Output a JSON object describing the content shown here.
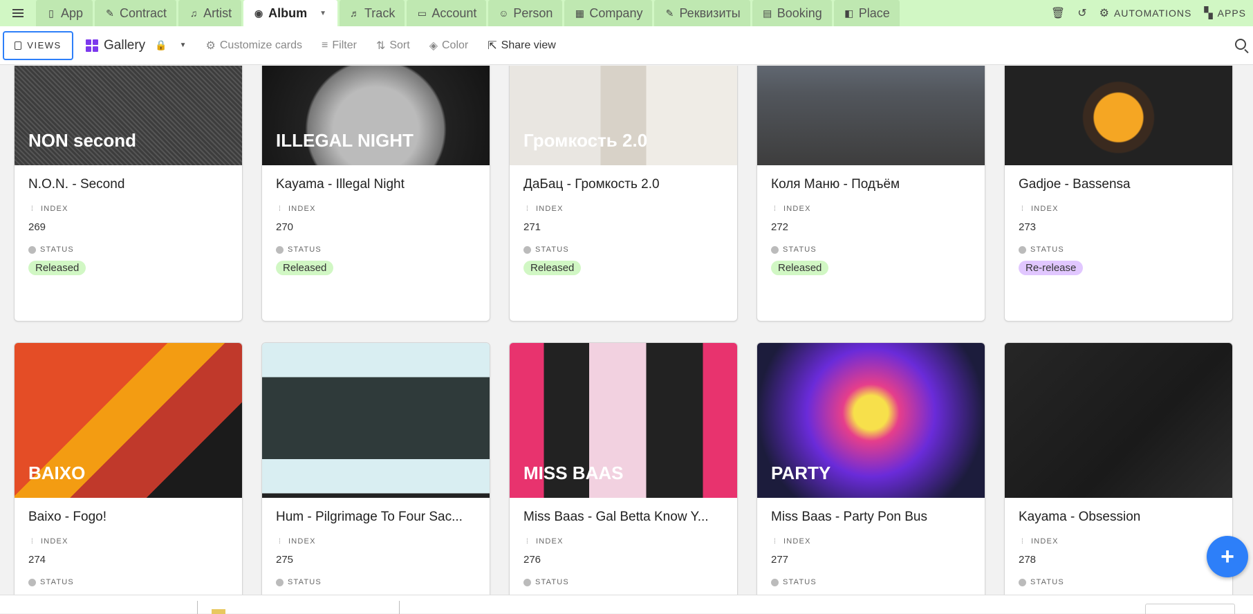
{
  "tabs": [
    {
      "label": "App",
      "icon": "phone-icon",
      "glyph": "▯"
    },
    {
      "label": "Contract",
      "icon": "document-icon",
      "glyph": "✎"
    },
    {
      "label": "Artist",
      "icon": "guitar-icon",
      "glyph": "♫"
    },
    {
      "label": "Album",
      "icon": "disc-icon",
      "glyph": "◉",
      "active": true
    },
    {
      "label": "Track",
      "icon": "music-icon",
      "glyph": "♬"
    },
    {
      "label": "Account",
      "icon": "wallet-icon",
      "glyph": "▭"
    },
    {
      "label": "Person",
      "icon": "people-icon",
      "glyph": "☺"
    },
    {
      "label": "Company",
      "icon": "building-icon",
      "glyph": "▦"
    },
    {
      "label": "Реквизиты",
      "icon": "pen-icon",
      "glyph": "✎"
    },
    {
      "label": "Booking",
      "icon": "calendar-icon",
      "glyph": "▤"
    },
    {
      "label": "Place",
      "icon": "map-icon",
      "glyph": "◧"
    }
  ],
  "tab_actions": {
    "automations": "AUTOMATIONS",
    "apps": "APPS"
  },
  "toolbar": {
    "views": "VIEWS",
    "view_name": "Gallery",
    "customize": "Customize cards",
    "filter": "Filter",
    "sort": "Sort",
    "color": "Color",
    "share": "Share view"
  },
  "field_labels": {
    "index": "INDEX",
    "status": "STATUS"
  },
  "cards": [
    {
      "title": "N.O.N. - Second",
      "index": "269",
      "status": "Released",
      "art": "art-non",
      "art_text": "NON second"
    },
    {
      "title": "Kayama - Illegal Night",
      "index": "270",
      "status": "Released",
      "art": "art-illegal",
      "art_text": "ILLEGAL NIGHT"
    },
    {
      "title": "ДаБац - Громкость 2.0",
      "index": "271",
      "status": "Released",
      "art": "art-dabac",
      "art_text": "Громкость 2.0"
    },
    {
      "title": "Коля Маню - Подъём",
      "index": "272",
      "status": "Released",
      "art": "art-kolya",
      "art_text": ""
    },
    {
      "title": "Gadjoe - Bassensa",
      "index": "273",
      "status": "Re-release",
      "art": "art-gadjoe",
      "art_text": ""
    },
    {
      "title": "Baixo - Fogo!",
      "index": "274",
      "status": "",
      "art": "art-baixo",
      "art_text": "BAIXO"
    },
    {
      "title": "Hum - Pilgrimage To Four Sac...",
      "index": "275",
      "status": "",
      "art": "art-hum",
      "art_text": ""
    },
    {
      "title": "Miss Baas - Gal Betta Know Y...",
      "index": "276",
      "status": "",
      "art": "art-missbaas",
      "art_text": "MISS BAAS"
    },
    {
      "title": "Miss Baas - Party Pon Bus",
      "index": "277",
      "status": "",
      "art": "art-party",
      "art_text": "PARTY"
    },
    {
      "title": "Kayama - Obsession",
      "index": "278",
      "status": "",
      "art": "art-obsession",
      "art_text": ""
    }
  ],
  "colors": {
    "tabbar": "#d1f7c4",
    "accent": "#2d7ff9",
    "released": "#d1f7c4",
    "rerelease": "#e1c7ff",
    "gallery_icon": "#7c39ed"
  },
  "fab": {
    "label": "+"
  }
}
